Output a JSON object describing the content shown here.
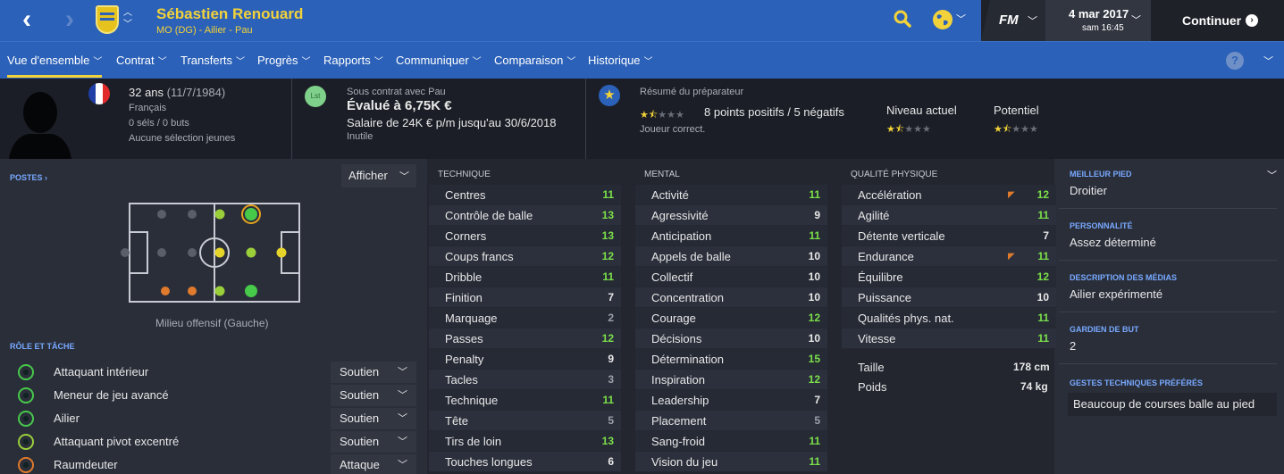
{
  "header": {
    "player_name": "Sébastien Renouard",
    "player_sub": "MO (DG) - Ailier - Pau",
    "date": "4 mar 2017",
    "time": "sam 16:45",
    "continue_label": "Continuer",
    "fm_label": "FM"
  },
  "nav": {
    "items": [
      {
        "label": "Vue d'ensemble"
      },
      {
        "label": "Contrat"
      },
      {
        "label": "Transferts"
      },
      {
        "label": "Progrès"
      },
      {
        "label": "Rapports"
      },
      {
        "label": "Communiquer"
      },
      {
        "label": "Comparaison"
      },
      {
        "label": "Historique"
      }
    ],
    "help": "?"
  },
  "profile": {
    "age": "32 ans",
    "dob": "(11/7/1984)",
    "nationality": "Français",
    "caps": "0 séls / 0 buts",
    "youth": "Aucune sélection jeunes"
  },
  "contract": {
    "badge": "Lst",
    "under": "Sous contrat avec Pau",
    "value": "Évalué à 6,75K €",
    "salary": "Salaire de 24K € p/m jusqu'au 30/6/2018",
    "status": "Inutile"
  },
  "coach": {
    "title": "Résumé du préparateur",
    "points": "8 points positifs / 5 négatifs",
    "verdict": "Joueur correct.",
    "current_label": "Niveau actuel",
    "potential_label": "Potentiel",
    "stars": 1.5
  },
  "positions": {
    "label": "POSTES",
    "show_button": "Afficher",
    "caption": "Milieu offensif (Gauche)"
  },
  "roles": {
    "label": "RÔLE ET TÂCHE",
    "items": [
      {
        "name": "Attaquant intérieur",
        "duty": "Soutien",
        "color": "#47c94a"
      },
      {
        "name": "Meneur de jeu avancé",
        "duty": "Soutien",
        "color": "#47c94a"
      },
      {
        "name": "Ailier",
        "duty": "Soutien",
        "color": "#47c94a"
      },
      {
        "name": "Attaquant pivot excentré",
        "duty": "Soutien",
        "color": "#9bcf3a"
      },
      {
        "name": "Raumdeuter",
        "duty": "Attaque",
        "color": "#e07a2c"
      }
    ]
  },
  "attributes": {
    "technique_label": "TECHNIQUE",
    "mental_label": "MENTAL",
    "physical_label": "QUALITÉ PHYSIQUE",
    "technique": [
      {
        "name": "Centres",
        "value": "11"
      },
      {
        "name": "Contrôle de balle",
        "value": "13"
      },
      {
        "name": "Corners",
        "value": "13"
      },
      {
        "name": "Coups francs",
        "value": "12"
      },
      {
        "name": "Dribble",
        "value": "11"
      },
      {
        "name": "Finition",
        "value": "7"
      },
      {
        "name": "Marquage",
        "value": "2"
      },
      {
        "name": "Passes",
        "value": "12"
      },
      {
        "name": "Penalty",
        "value": "9"
      },
      {
        "name": "Tacles",
        "value": "3"
      },
      {
        "name": "Technique",
        "value": "11"
      },
      {
        "name": "Tête",
        "value": "5"
      },
      {
        "name": "Tirs de loin",
        "value": "13"
      },
      {
        "name": "Touches longues",
        "value": "6"
      }
    ],
    "mental": [
      {
        "name": "Activité",
        "value": "11"
      },
      {
        "name": "Agressivité",
        "value": "9"
      },
      {
        "name": "Anticipation",
        "value": "11"
      },
      {
        "name": "Appels de balle",
        "value": "10"
      },
      {
        "name": "Collectif",
        "value": "10"
      },
      {
        "name": "Concentration",
        "value": "10"
      },
      {
        "name": "Courage",
        "value": "12"
      },
      {
        "name": "Décisions",
        "value": "10"
      },
      {
        "name": "Détermination",
        "value": "15"
      },
      {
        "name": "Inspiration",
        "value": "12"
      },
      {
        "name": "Leadership",
        "value": "7"
      },
      {
        "name": "Placement",
        "value": "5"
      },
      {
        "name": "Sang-froid",
        "value": "11"
      },
      {
        "name": "Vision du jeu",
        "value": "11"
      }
    ],
    "physical": [
      {
        "name": "Accélération",
        "value": "12"
      },
      {
        "name": "Agilité",
        "value": "11"
      },
      {
        "name": "Détente verticale",
        "value": "7"
      },
      {
        "name": "Endurance",
        "value": "11"
      },
      {
        "name": "Équilibre",
        "value": "12"
      },
      {
        "name": "Puissance",
        "value": "10"
      },
      {
        "name": "Qualités phys. nat.",
        "value": "11"
      },
      {
        "name": "Vitesse",
        "value": "11"
      }
    ],
    "height_label": "Taille",
    "height": "178 cm",
    "weight_label": "Poids",
    "weight": "74 kg"
  },
  "side": {
    "foot_label": "MEILLEUR PIED",
    "foot": "Droitier",
    "personality_label": "PERSONNALITÉ",
    "personality": "Assez déterminé",
    "media_label": "DESCRIPTION DES MÉDIAS",
    "media": "Ailier expérimenté",
    "gk_label": "GARDIEN DE BUT",
    "gk": "2",
    "traits_label": "GESTES TECHNIQUES PRÉFÉRÉS",
    "traits": "Beaucoup de courses balle au pied"
  }
}
